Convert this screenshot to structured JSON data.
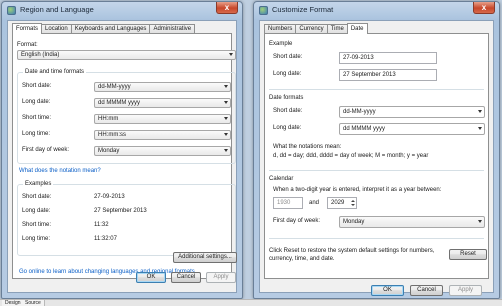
{
  "region_window": {
    "title": "Region and Language",
    "close_glyph": "x",
    "tabs": [
      "Formats",
      "Location",
      "Keyboards and Languages",
      "Administrative"
    ],
    "format_label": "Format:",
    "format_value": "English (India)",
    "date_time_group": "Date and time formats",
    "rows": [
      {
        "label": "Short date:",
        "value": "dd-MM-yyyy"
      },
      {
        "label": "Long date:",
        "value": "dd MMMM yyyy"
      },
      {
        "label": "Short time:",
        "value": "HH:mm"
      },
      {
        "label": "Long time:",
        "value": "HH:mm:ss"
      },
      {
        "label": "First day of week:",
        "value": "Monday"
      }
    ],
    "notation_link": "What does the notation mean?",
    "examples_group": "Examples",
    "examples": [
      {
        "label": "Short date:",
        "value": "27-09-2013"
      },
      {
        "label": "Long date:",
        "value": "27 September 2013"
      },
      {
        "label": "Short time:",
        "value": "11:32"
      },
      {
        "label": "Long time:",
        "value": "11:32:07"
      }
    ],
    "additional_settings": "Additional settings...",
    "online_link": "Go online to learn about changing languages and regional formats",
    "ok": "OK",
    "cancel": "Cancel",
    "apply": "Apply"
  },
  "customize_window": {
    "title": "Customize Format",
    "close_glyph": "x",
    "tabs": [
      "Numbers",
      "Currency",
      "Time",
      "Date"
    ],
    "example_group": "Example",
    "example_rows": [
      {
        "label": "Short date:",
        "value": "27-09-2013"
      },
      {
        "label": "Long date:",
        "value": "27 September 2013"
      }
    ],
    "formats_group": "Date formats",
    "format_rows": [
      {
        "label": "Short date:",
        "value": "dd-MM-yyyy"
      },
      {
        "label": "Long date:",
        "value": "dd MMMM yyyy"
      }
    ],
    "notation_title": "What the notations mean:",
    "notation_text": "d, dd = day;  ddd, dddd = day of week;  M = month;  y = year",
    "calendar_group": "Calendar",
    "calendar_text": "When a two-digit year is entered, interpret it as a year between:",
    "year_from": "1930",
    "and_label": "and",
    "year_to": "2029",
    "first_day_label": "First day of week:",
    "first_day_value": "Monday",
    "reset_text": "Click Reset to restore the system default settings for numbers, currency, time, and date.",
    "reset": "Reset",
    "ok": "OK",
    "cancel": "Cancel",
    "apply": "Apply"
  },
  "bottom_strip": {
    "tabs": [
      "Design",
      "Source"
    ]
  }
}
